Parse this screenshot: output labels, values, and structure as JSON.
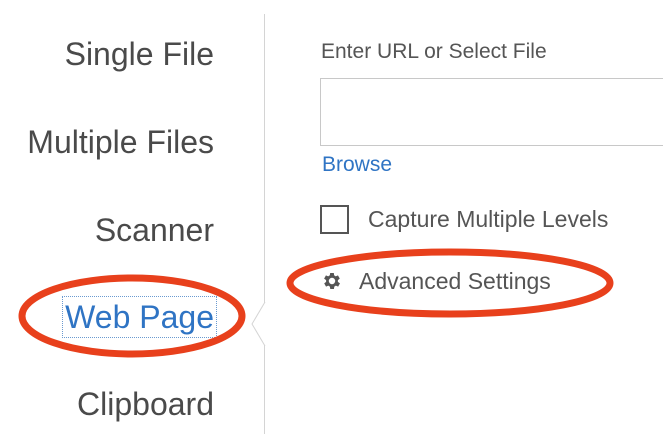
{
  "nav": {
    "items": [
      {
        "label": "Single File",
        "active": false
      },
      {
        "label": "Multiple Files",
        "active": false
      },
      {
        "label": "Scanner",
        "active": false
      },
      {
        "label": "Web Page",
        "active": true
      },
      {
        "label": "Clipboard",
        "active": false
      }
    ]
  },
  "main": {
    "url_field_label": "Enter URL or Select File",
    "url_value": "",
    "browse_label": "Browse",
    "capture_multiple_levels_label": "Capture Multiple Levels",
    "capture_multiple_levels_checked": false,
    "advanced_settings_label": "Advanced Settings",
    "advanced_settings_icon": "gear-icon"
  },
  "colors": {
    "accent": "#2f74c4",
    "text": "#4a4a4a",
    "annotation": "#e8401c"
  }
}
